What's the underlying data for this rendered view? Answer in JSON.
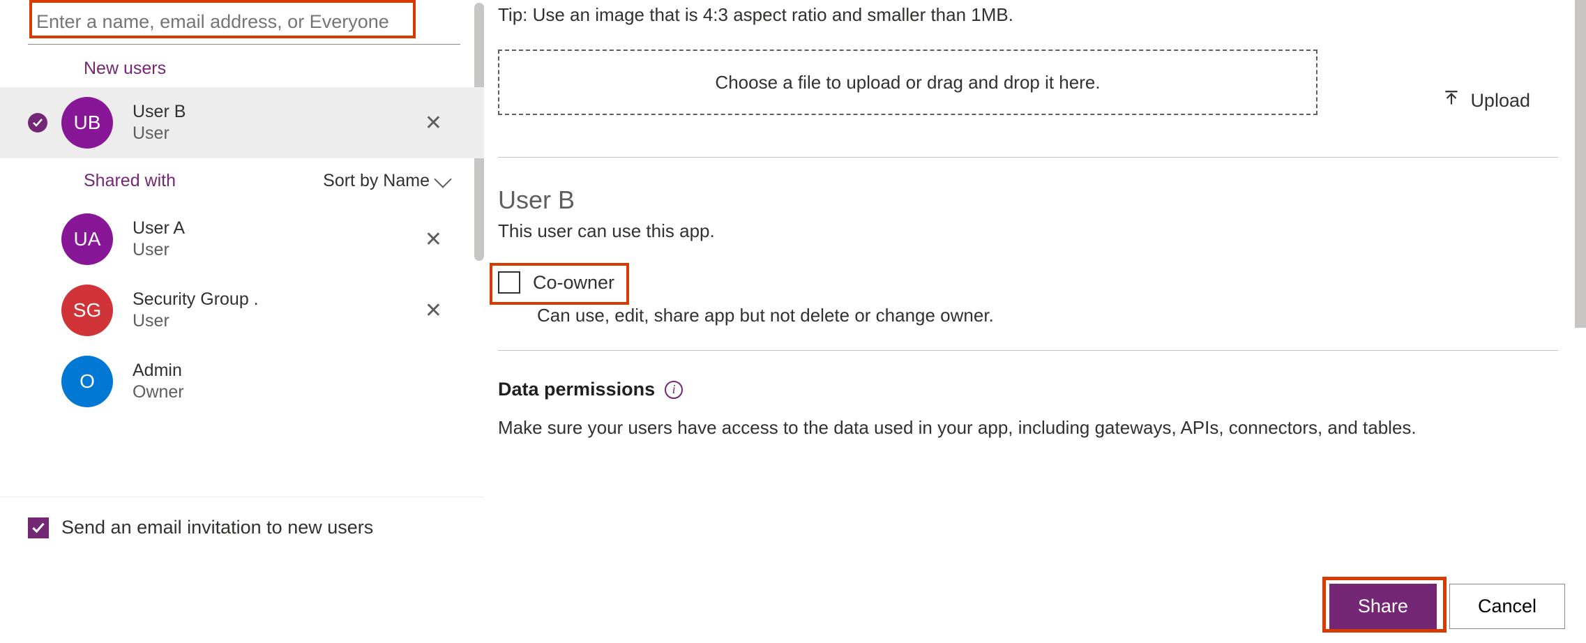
{
  "search": {
    "placeholder": "Enter a name, email address, or Everyone"
  },
  "sections": {
    "new_users": "New users",
    "shared_with": "Shared with",
    "sort": "Sort by Name"
  },
  "users": {
    "new": [
      {
        "initials": "UB",
        "name": "User B",
        "role": "User"
      }
    ],
    "shared": [
      {
        "initials": "UA",
        "name": "User A",
        "role": "User",
        "removable": true
      },
      {
        "initials": "SG",
        "name": "Security Group .",
        "role": "User",
        "removable": true
      },
      {
        "initials": "O",
        "name": "Admin",
        "role": "Owner",
        "removable": false
      }
    ]
  },
  "email_invite": {
    "label": "Send an email invitation to new users",
    "checked": true
  },
  "right": {
    "tip": "Tip: Use an image that is 4:3 aspect ratio and smaller than 1MB.",
    "dropzone": "Choose a file to upload or drag and drop it here.",
    "upload": "Upload",
    "selected_user": "User B",
    "selected_desc": "This user can use this app.",
    "coowner_label": "Co-owner",
    "coowner_desc": "Can use, edit, share app but not delete or change owner.",
    "perm_title": "Data permissions",
    "perm_desc": "Make sure your users have access to the data used in your app, including gateways, APIs, connectors, and tables."
  },
  "buttons": {
    "share": "Share",
    "cancel": "Cancel"
  }
}
